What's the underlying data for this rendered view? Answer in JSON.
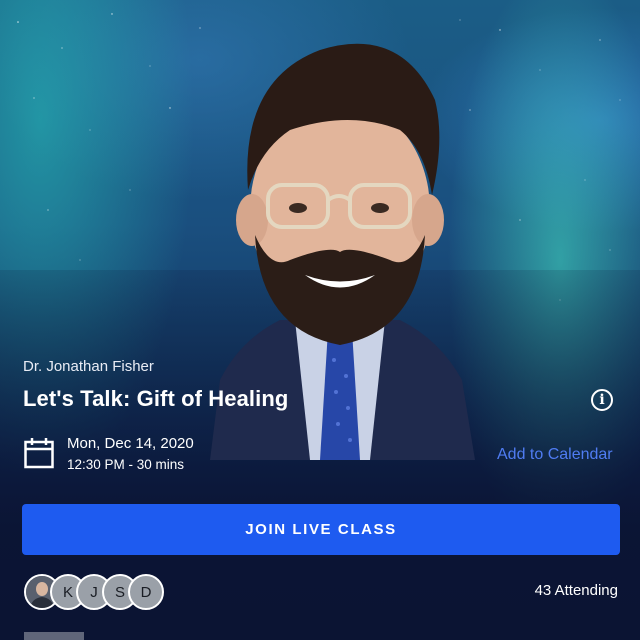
{
  "event": {
    "instructor": "Dr. Jonathan Fisher",
    "title": "Let's Talk: Gift of Healing",
    "date": "Mon, Dec 14, 2020",
    "time": "12:30 PM - 30 mins"
  },
  "actions": {
    "add_calendar_label": "Add to Calendar",
    "join_label": "JOIN LIVE CLASS"
  },
  "attendees": {
    "initials": [
      "K",
      "J",
      "S",
      "D"
    ],
    "count_label": "43 Attending"
  },
  "colors": {
    "accent": "#1e5bf0",
    "link": "#4f7cf2",
    "background": "#0b1433"
  },
  "icons": [
    "info-icon",
    "calendar-icon"
  ]
}
